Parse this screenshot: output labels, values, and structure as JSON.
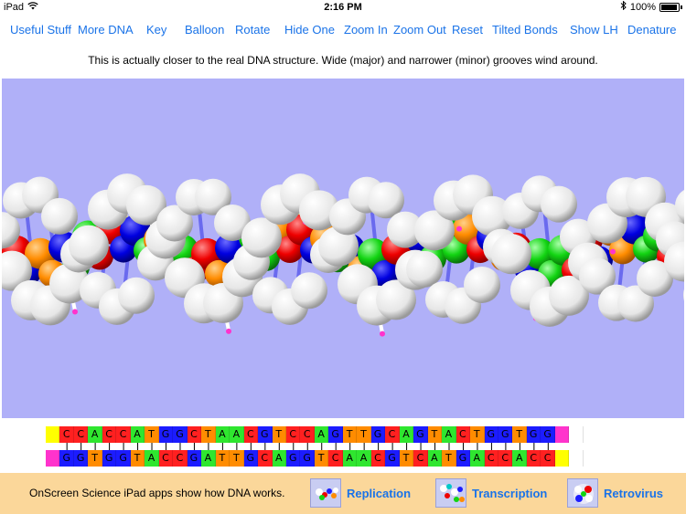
{
  "status_bar": {
    "device": "iPad",
    "time": "2:16 PM",
    "battery": "100%"
  },
  "toolbar": {
    "buttons": [
      "Useful Stuff",
      "More DNA",
      "Key",
      "Balloon",
      "Rotate",
      "Hide One",
      "Zoom In",
      "Zoom Out",
      "Reset",
      "Tilted Bonds",
      "Show LH",
      "Denature"
    ]
  },
  "caption": "This is actually closer to the real DNA structure. Wide (major) and narrower (minor) grooves wind around.",
  "sequence": {
    "strand1": [
      "",
      "C",
      "C",
      "A",
      "C",
      "C",
      "A",
      "T",
      "G",
      "G",
      "C",
      "T",
      "A",
      "A",
      "C",
      "G",
      "T",
      "C",
      "C",
      "A",
      "G",
      "T",
      "T",
      "G",
      "C",
      "A",
      "G",
      "T",
      "A",
      "C",
      "T",
      "G",
      "G",
      "T",
      "G",
      "G",
      "",
      ""
    ],
    "strand2": [
      "",
      "G",
      "G",
      "T",
      "G",
      "G",
      "T",
      "A",
      "C",
      "C",
      "G",
      "A",
      "T",
      "T",
      "G",
      "C",
      "A",
      "G",
      "G",
      "T",
      "C",
      "A",
      "A",
      "C",
      "G",
      "T",
      "C",
      "A",
      "T",
      "G",
      "A",
      "C",
      "C",
      "A",
      "C",
      "C",
      "",
      ""
    ]
  },
  "colors": {
    "A": "#2fe62f",
    "T": "#ff8c00",
    "G": "#1c1cff",
    "C": "#ff2020",
    "strand1_end_left": "#ffff00",
    "strand1_end_right": "#ff33cc",
    "strand2_end_left": "#ff33cc",
    "strand2_end_right": "#ffff00",
    "view_bg": "#b0b0f8",
    "bottom_bg": "#fbd79a",
    "link": "#1a73e8"
  },
  "bottom_bar": {
    "promo_text": "OnScreen Science iPad apps show how DNA works.",
    "apps": [
      {
        "label": "Replication",
        "icon": "replication-icon"
      },
      {
        "label": "Transcription",
        "icon": "transcription-icon"
      },
      {
        "label": "Retrovirus",
        "icon": "retrovirus-icon"
      }
    ]
  }
}
